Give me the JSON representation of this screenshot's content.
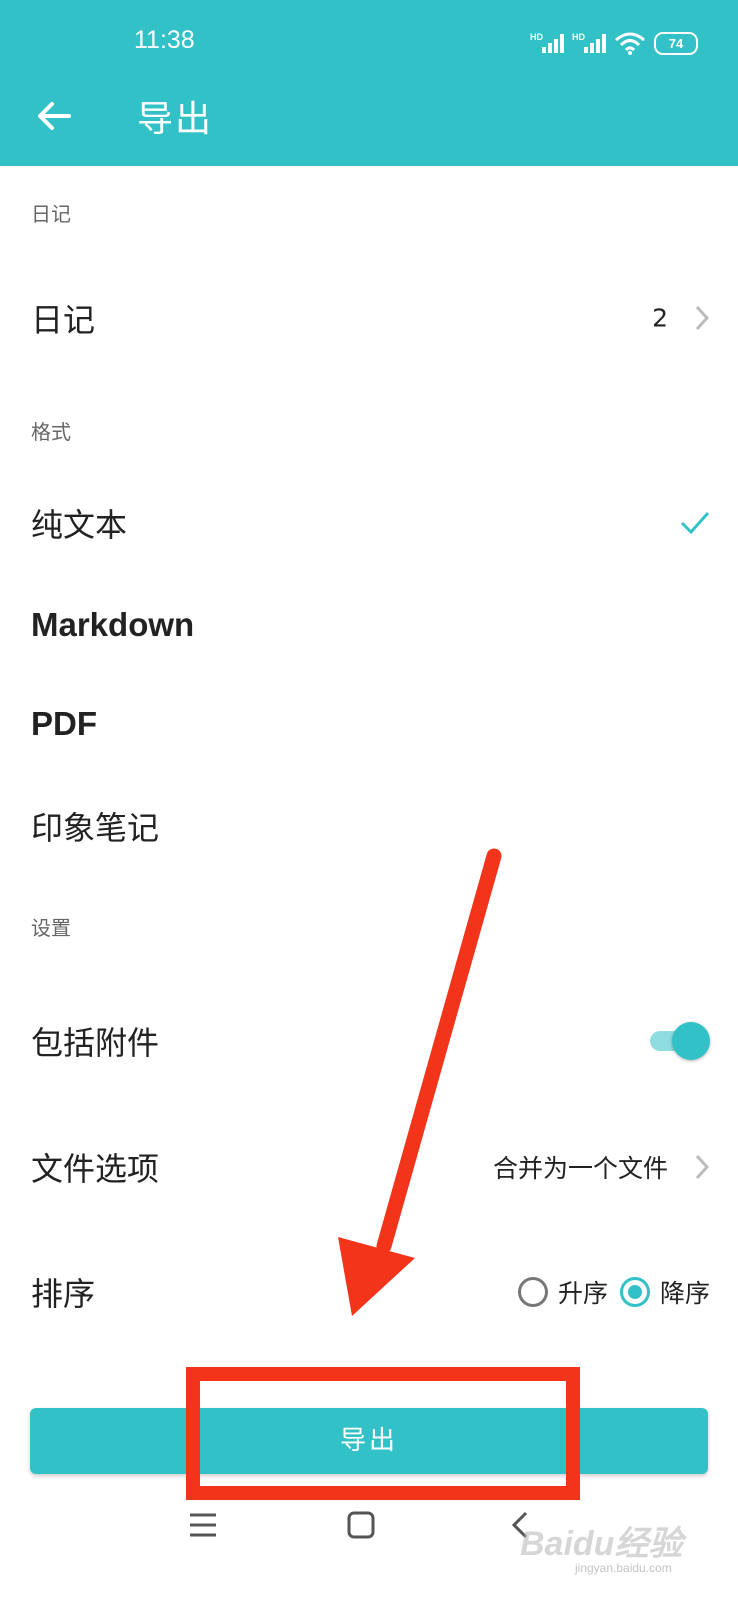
{
  "status_bar": {
    "time": "11:38",
    "network_1": "HD",
    "network_2": "HD",
    "battery": "74"
  },
  "app_bar": {
    "title": "导出",
    "back_icon": "arrow-left-icon"
  },
  "sections": {
    "diary_header": "日记",
    "format_header": "格式",
    "settings_header": "设置"
  },
  "diary_row": {
    "label": "日记",
    "value": "2"
  },
  "formats": [
    {
      "label": "纯文本",
      "selected": true
    },
    {
      "label": "Markdown",
      "selected": false
    },
    {
      "label": "PDF",
      "selected": false
    },
    {
      "label": "印象笔记",
      "selected": false
    }
  ],
  "settings": {
    "attachments_label": "包括附件",
    "attachments_enabled": true,
    "file_option_label": "文件选项",
    "file_option_value": "合并为一个文件",
    "sort_label": "排序",
    "sort_asc": "升序",
    "sort_desc": "降序",
    "sort_selected": "降序"
  },
  "export_button": "导出",
  "watermark": {
    "logo": "Baidu经验",
    "url": "jingyan.baidu.com"
  },
  "colors": {
    "accent": "#33c1c8",
    "annotation": "#f1341a"
  }
}
